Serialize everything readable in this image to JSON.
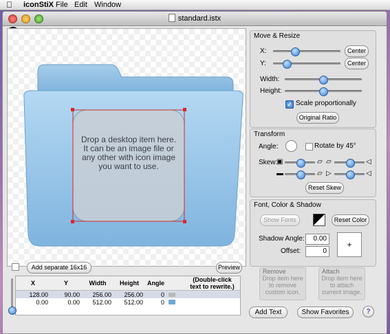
{
  "menubar": {
    "app_name": "iconStiX",
    "menus": [
      "File",
      "Edit",
      "Window"
    ]
  },
  "window": {
    "title": "standard.istx"
  },
  "canvas": {
    "drop_hint": "Drop a desktop item here.\nIt can be an image file or any other with icon image you want to use."
  },
  "toolbar": {
    "add_separate_label": "Add separate 16x16",
    "preview_label": "Preview"
  },
  "table": {
    "columns": [
      "X",
      "Y",
      "Width",
      "Height",
      "Angle",
      "",
      "(Double-click text to rewrite.)"
    ],
    "rows": [
      [
        "128.00",
        "90.00",
        "256.00",
        "256.00",
        "0"
      ],
      [
        "0.00",
        "0.00",
        "512.00",
        "512.00",
        "0"
      ]
    ]
  },
  "move_resize": {
    "title": "Move & Resize",
    "x_label": "X:",
    "y_label": "Y:",
    "center_label": "Center",
    "width_label": "Width:",
    "height_label": "Height:",
    "scale_label": "Scale proportionally",
    "original_ratio_label": "Original Ratio"
  },
  "transform": {
    "title": "Transform",
    "angle_label": "Angle:",
    "rotate_label": "Rotate by 45°",
    "skew_label": "Skew:",
    "reset_skew_label": "Reset Skew"
  },
  "font_color": {
    "title": "Font, Color & Shadow",
    "show_fonts_label": "Show Fonts",
    "reset_color_label": "Reset Color",
    "shadow_angle_label": "Shadow Angle:",
    "shadow_angle_value": "0.00",
    "offset_label": "Offset:",
    "offset_value": "0",
    "plus_symbol": "+"
  },
  "remove": {
    "title": "Remove",
    "hint": "Drop item here\nto remove\ncustom icon."
  },
  "attach": {
    "title": "Attach",
    "hint": "Drop item here\nto attach\ncurrent image."
  },
  "bottom": {
    "add_text_label": "Add Text",
    "show_favorites_label": "Show Favorites",
    "help_symbol": "?"
  },
  "colors": {
    "accent": "#3a7fd0",
    "folder": "#8fbde0",
    "selection": "#d42a2a"
  }
}
